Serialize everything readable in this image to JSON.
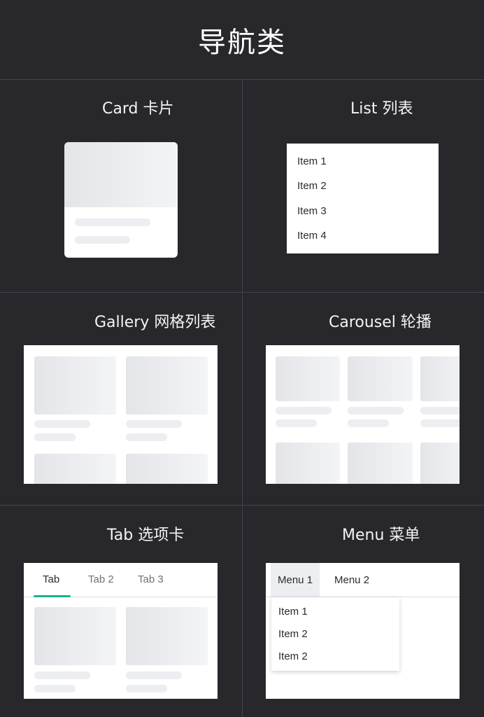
{
  "page": {
    "title": "导航类"
  },
  "cells": {
    "card": {
      "label": "Card 卡片"
    },
    "list": {
      "label": "List  列表",
      "items": [
        "Item 1",
        "Item 2",
        "Item 3",
        "Item 4"
      ]
    },
    "gallery": {
      "label": "Gallery 网格列表"
    },
    "carousel": {
      "label": "Carousel  轮播"
    },
    "tab": {
      "label": "Tab  选项卡",
      "tabs": [
        "Tab",
        "Tab 2",
        "Tab 3"
      ],
      "active_index": 0
    },
    "menu": {
      "label": "Menu  菜单",
      "buttons": [
        "Menu 1",
        "Menu 2"
      ],
      "dropdown_items": [
        "Item 1",
        "Item 2",
        "Item 2"
      ]
    }
  },
  "colors": {
    "background": "#28272c",
    "accent": "#17b38f",
    "panel": "#ffffff",
    "divider": "#45444a"
  }
}
